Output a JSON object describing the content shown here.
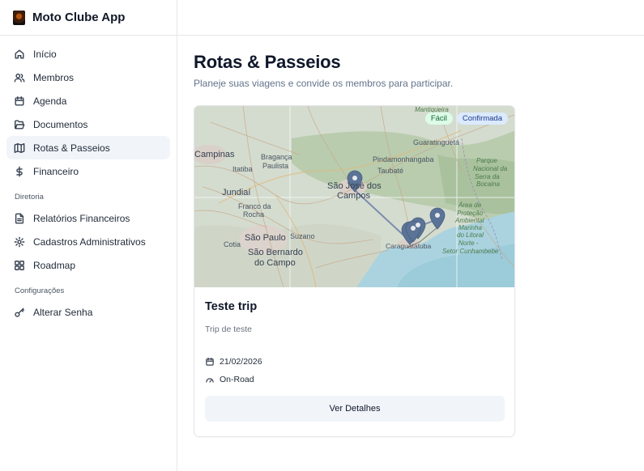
{
  "app": {
    "name": "Moto Clube App"
  },
  "sidebar": {
    "items": [
      {
        "label": "Início",
        "icon": "home-icon"
      },
      {
        "label": "Membros",
        "icon": "users-icon"
      },
      {
        "label": "Agenda",
        "icon": "calendar-icon"
      },
      {
        "label": "Documentos",
        "icon": "folder-icon"
      },
      {
        "label": "Rotas & Passeios",
        "icon": "map-icon",
        "active": true
      },
      {
        "label": "Financeiro",
        "icon": "dollar-icon"
      }
    ],
    "sections": [
      {
        "label": "Diretoria",
        "items": [
          {
            "label": "Relatórios Financeiros",
            "icon": "file-icon"
          },
          {
            "label": "Cadastros Administrativos",
            "icon": "gear-icon"
          },
          {
            "label": "Roadmap",
            "icon": "grid-icon"
          }
        ]
      },
      {
        "label": "Configurações",
        "items": [
          {
            "label": "Alterar Senha",
            "icon": "key-icon"
          }
        ]
      }
    ]
  },
  "page": {
    "title": "Rotas & Passeios",
    "subtitle": "Planeje suas viagens e convide os membros para participar."
  },
  "trip": {
    "badges": {
      "difficulty": "Fácil",
      "status": "Confirmada"
    },
    "title": "Teste trip",
    "description": "Trip de teste",
    "date": "21/02/2026",
    "type": "On-Road",
    "details_label": "Ver Detalhes"
  },
  "map": {
    "labels": {
      "campinas": "Campinas",
      "braganca": "Bragança",
      "paulista": "Paulista",
      "itatiba": "Itatiba",
      "jundiai": "Jundiaí",
      "franco": "Franco da",
      "rocha": "Rocha",
      "cotia": "Cotia",
      "sao_paulo": "São Paulo",
      "sao_bernardo": "São Bernardo",
      "do_campo": "do Campo",
      "suzano": "Suzano",
      "sjc": "São José dos",
      "sjc2": "Campos",
      "taubate": "Taubaté",
      "pinda": "Pindamonhangaba",
      "guaratingueta": "Guaratinguetá",
      "mantiqueira": "Mantiqueira",
      "caragua": "Caraguatatuba",
      "parque1": "Parque",
      "parque2": "Nacional da",
      "parque3": "Serra da",
      "parque4": "Bocaina",
      "area1": "Área de",
      "area2": "Proteção",
      "area3": "Ambiental",
      "area4": "Marinha",
      "area5": "do Litoral",
      "area6": "Norte -",
      "area7": "Setor Cunhambebe"
    },
    "marker_color": "#5b7396"
  }
}
